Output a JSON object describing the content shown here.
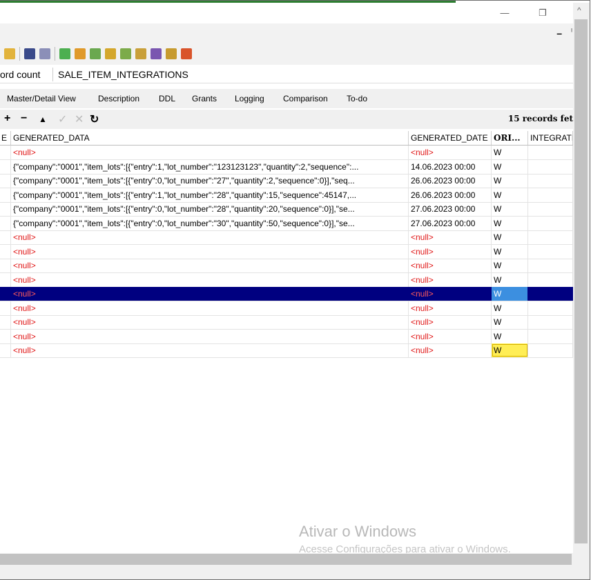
{
  "window": {
    "minimize": "—",
    "restore": "❐"
  },
  "mdi": {
    "minimize": "–",
    "close": "ᴵ"
  },
  "colors": {
    "selection": "#000080",
    "null_text": "#e01515",
    "highlight": "#ffee55"
  },
  "toolbar_icons": [
    "key-icon",
    "table-icon",
    "edit-icon",
    "green-tool-icon",
    "table-orange-icon",
    "table-green-icon",
    "gear-table-icon",
    "table-wrench-icon",
    "table-copy-icon",
    "check-icon",
    "table-fx-icon",
    "table-search-icon"
  ],
  "record": {
    "label": "ord count",
    "table_name": "SALE_ITEM_INTEGRATIONS"
  },
  "tabs": [
    "Master/Detail View",
    "Description",
    "DDL",
    "Grants",
    "Logging",
    "Comparison",
    "To-do"
  ],
  "nav": {
    "add": "+",
    "delete": "−",
    "up": "▲",
    "post": "✓",
    "cancel": "✕",
    "refresh": "↻"
  },
  "status": {
    "fetched": "15 records fet"
  },
  "grid": {
    "columns": [
      "E",
      "GENERATED_DATA",
      "GENERATED_DATE",
      "ORI...",
      "INTEGRATI"
    ],
    "rows": [
      {
        "data": "<null>",
        "date": "<null>",
        "ori": "W"
      },
      {
        "data": "{\"company\":\"0001\",\"item_lots\":[{\"entry\":1,\"lot_number\":\"123123123\",\"quantity\":2,\"sequence\":...",
        "date": "14.06.2023 00:00",
        "ori": "W"
      },
      {
        "data": "{\"company\":\"0001\",\"item_lots\":[{\"entry\":0,\"lot_number\":\"27\",\"quantity\":2,\"sequence\":0}],\"seq...",
        "date": "26.06.2023 00:00",
        "ori": "W"
      },
      {
        "data": "{\"company\":\"0001\",\"item_lots\":[{\"entry\":1,\"lot_number\":\"28\",\"quantity\":15,\"sequence\":45147,...",
        "date": "26.06.2023 00:00",
        "ori": "W"
      },
      {
        "data": "{\"company\":\"0001\",\"item_lots\":[{\"entry\":0,\"lot_number\":\"28\",\"quantity\":20,\"sequence\":0}],\"se...",
        "date": "27.06.2023 00:00",
        "ori": "W"
      },
      {
        "data": "{\"company\":\"0001\",\"item_lots\":[{\"entry\":0,\"lot_number\":\"30\",\"quantity\":50,\"sequence\":0}],\"se...",
        "date": "27.06.2023 00:00",
        "ori": "W"
      },
      {
        "data": "<null>",
        "date": "<null>",
        "ori": "W"
      },
      {
        "data": "<null>",
        "date": "<null>",
        "ori": "W"
      },
      {
        "data": "<null>",
        "date": "<null>",
        "ori": "W"
      },
      {
        "data": "<null>",
        "date": "<null>",
        "ori": "W"
      },
      {
        "data": "<null>",
        "date": "<null>",
        "ori": "W"
      },
      {
        "data": "<null>",
        "date": "<null>",
        "ori": "W"
      },
      {
        "data": "<null>",
        "date": "<null>",
        "ori": "W"
      },
      {
        "data": "<null>",
        "date": "<null>",
        "ori": "W"
      },
      {
        "data": "<null>",
        "date": "<null>",
        "ori": "W"
      }
    ],
    "selected_row": 10,
    "highlighted_row": 14
  },
  "watermark": {
    "title": "Ativar o Windows",
    "subtitle": "Acesse Configurações para ativar o Windows."
  }
}
